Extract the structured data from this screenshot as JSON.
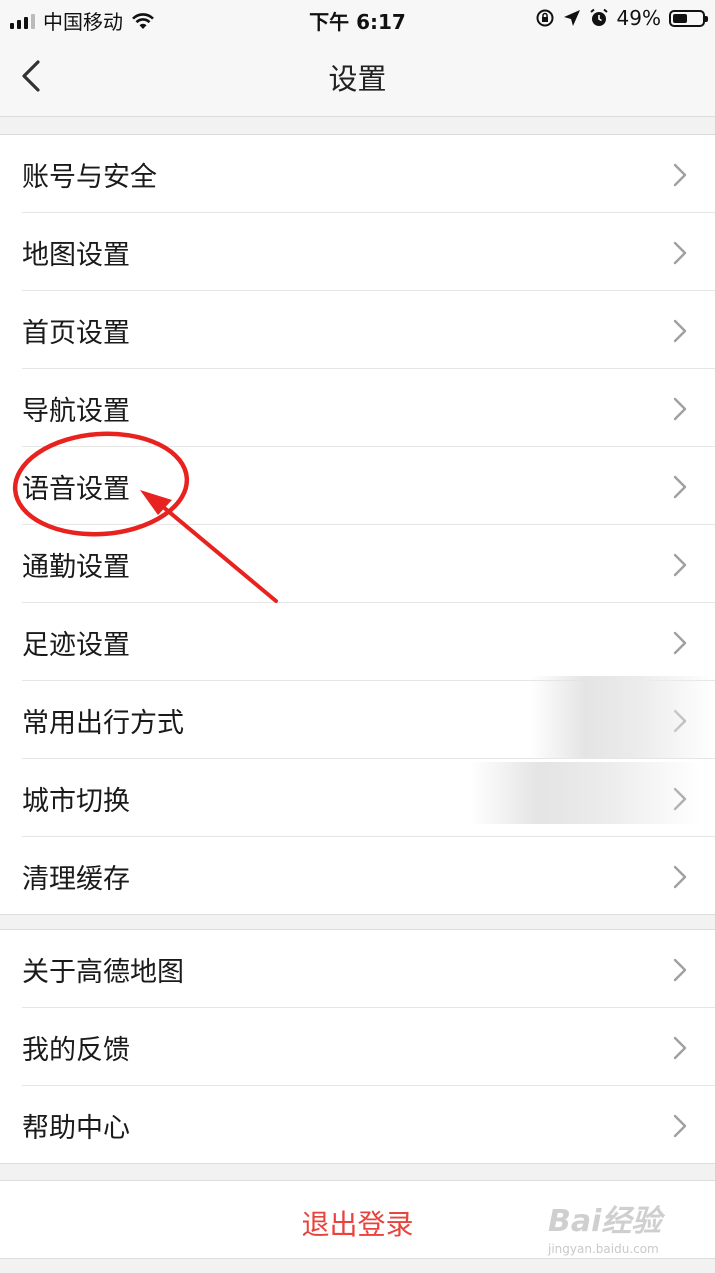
{
  "status_bar": {
    "carrier": "中国移动",
    "time": "下午 6:17",
    "battery": "49%",
    "battery_level": 0.49
  },
  "nav": {
    "title": "设置"
  },
  "group1": [
    {
      "label": "账号与安全"
    },
    {
      "label": "地图设置"
    },
    {
      "label": "首页设置"
    },
    {
      "label": "导航设置"
    },
    {
      "label": "语音设置"
    },
    {
      "label": "通勤设置"
    },
    {
      "label": "足迹设置"
    },
    {
      "label": "常用出行方式"
    },
    {
      "label": "城市切换"
    },
    {
      "label": "清理缓存"
    }
  ],
  "group2": [
    {
      "label": "关于高德地图"
    },
    {
      "label": "我的反馈"
    },
    {
      "label": "帮助中心"
    }
  ],
  "logout_label": "退出登录",
  "colors": {
    "logout": "#e8433c",
    "annotation": "#e8231f"
  },
  "watermark": {
    "brand": "Bai经验",
    "url": "jingyan.baidu.com"
  }
}
